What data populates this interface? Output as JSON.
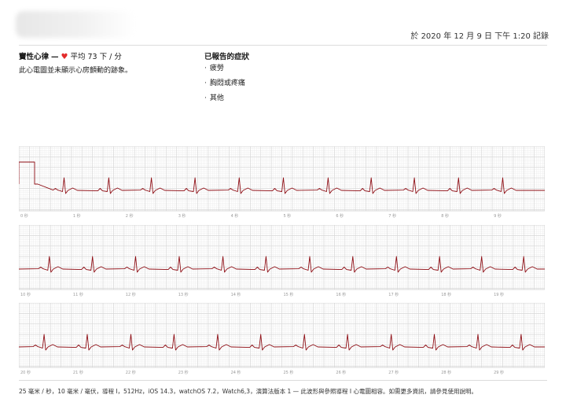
{
  "header": {
    "recorded_at": "於 2020 年 12 月 9 日 下午 1:20 記錄"
  },
  "summary": {
    "rhythm_label": "竇性心律",
    "separator": "—",
    "heart_icon": "heart-icon",
    "average_text": "平均 73 下 / 分",
    "description": "此心電圖並未顯示心房顫動的跡象。"
  },
  "symptoms": {
    "title": "已報告的症狀",
    "items": [
      "疲勞",
      "胸悶或疼痛",
      "其他"
    ]
  },
  "ecg": {
    "trace_color": "#8e0d14",
    "grid_major_color": "#d8d8d8",
    "grid_minor_color": "#eeeeee",
    "strips": [
      {
        "time_labels": [
          "0 秒",
          "1 秒",
          "2 秒",
          "3 秒",
          "4 秒",
          "5 秒",
          "6 秒",
          "7 秒",
          "8 秒",
          "9 秒"
        ],
        "beat_times_s": [
          0.86,
          1.71,
          2.52,
          3.35,
          4.19,
          5.03,
          5.88,
          6.7,
          7.52,
          8.36,
          9.2
        ]
      },
      {
        "time_labels": [
          "10 秒",
          "11 秒",
          "12 秒",
          "13 秒",
          "14 秒",
          "15 秒",
          "16 秒",
          "17 秒",
          "18 秒",
          "19 秒"
        ],
        "beat_times_s": [
          10.58,
          11.4,
          12.22,
          13.05,
          13.88,
          14.7,
          15.53,
          16.35,
          17.18,
          18.0,
          18.8,
          19.6
        ]
      },
      {
        "time_labels": [
          "20 秒",
          "21 秒",
          "22 秒",
          "23 秒",
          "24 秒",
          "25 秒",
          "26 秒",
          "27 秒",
          "28 秒",
          "29 秒"
        ],
        "beat_times_s": [
          20.48,
          21.3,
          22.13,
          22.95,
          23.78,
          24.6,
          25.43,
          26.25,
          27.08,
          27.9,
          28.73,
          29.55
        ]
      }
    ]
  },
  "footer": {
    "text": "25 毫米 / 秒，10 毫米 / 毫伏，導程 I，512Hz，iOS 14.3，watchOS 7.2，Watch6,3，演算法版本 1 — 此波形與參照導程 I 心電圖相容。如需更多資訊，請參見使用說明。"
  }
}
